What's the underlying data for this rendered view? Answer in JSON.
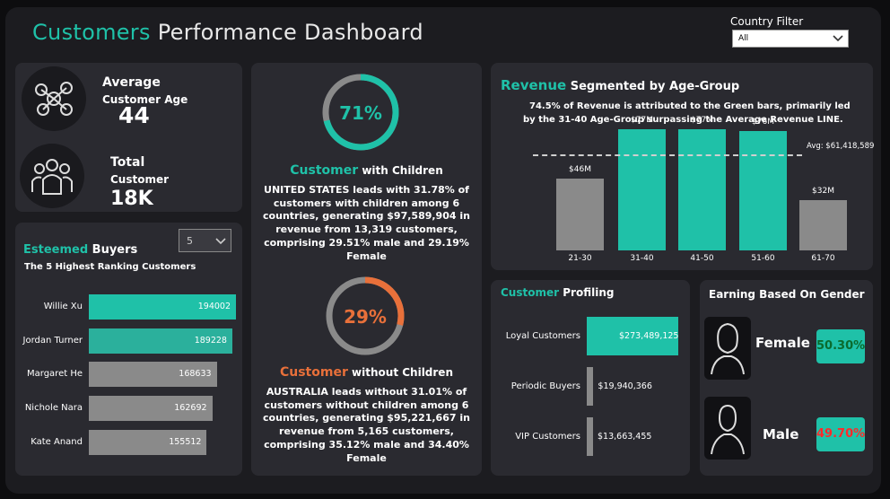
{
  "header": {
    "title_accent": "Customers",
    "title_rest": "Performance Dashboard",
    "filter_label": "Country Filter",
    "filter_value": "All"
  },
  "kpis": {
    "avg_age_label_1": "Average",
    "avg_age_label_2": "Customer Age",
    "avg_age_value": "44",
    "total_label_1": "Total",
    "total_label_2": "Customer",
    "total_value": "18K"
  },
  "buyers": {
    "title_accent": "Esteemed",
    "title_rest": "Buyers",
    "subtitle": "The 5 Highest Ranking Customers",
    "top_n": "5",
    "rows": [
      {
        "name": "Willie Xu",
        "value": 194002,
        "label": "194002",
        "color": "#1fc1a8"
      },
      {
        "name": "Jordan Turner",
        "value": 189228,
        "label": "189228",
        "color": "#2bb09c"
      },
      {
        "name": "Margaret He",
        "value": 168633,
        "label": "168633",
        "color": "#8a8a8a"
      },
      {
        "name": "Nichole Nara",
        "value": 162692,
        "label": "162692",
        "color": "#8a8a8a"
      },
      {
        "name": "Kate Anand",
        "value": 155512,
        "label": "155512",
        "color": "#8a8a8a"
      }
    ]
  },
  "children": {
    "with_pct": "71%",
    "with_fraction": 0.71,
    "with_title_accent": "Customer",
    "with_title_rest": "with Children",
    "with_desc": [
      "UNITED STATES leads with 31.78% of",
      "customers with children among 6",
      "countries, generating $97,589,904 in",
      "revenue from 13,319 customers,",
      "comprising 29.51% male and 29.19%",
      "Female"
    ],
    "without_pct": "29%",
    "without_fraction": 0.29,
    "without_title_accent": "Customer",
    "without_title_rest": "without Children",
    "without_desc": [
      "AUSTRALIA leads without 31.01% of",
      "customers without children among 6",
      "countries, generating $95,221,667 in",
      "revenue from 5,165 customers,",
      "comprising 35.12% male and 34.40%",
      "Female"
    ]
  },
  "revenue": {
    "title_accent": "Revenue",
    "title_rest": "Segmented by Age-Group",
    "desc_1": "74.5% of Revenue is attributed to the Green bars, primarily led",
    "desc_2": "by the 31-40 Age-Group surpassing the Average Revenue LINE.",
    "avg_label": "Avg: $61,418,589"
  },
  "profiling": {
    "title_accent": "Customer",
    "title_rest": "Profiling",
    "rows": [
      {
        "name": "Loyal Customers",
        "value": 273489125,
        "label": "$273,489,125"
      },
      {
        "name": "Periodic Buyers",
        "value": 19940366,
        "label": "$19,940,366"
      },
      {
        "name": "VIP Customers",
        "value": 13663455,
        "label": "$13,663,455"
      }
    ]
  },
  "gender": {
    "title": "Earning Based On Gender",
    "female_label": "Female",
    "female_pct": "50.30%",
    "male_label": "Male",
    "male_pct": "49.70%"
  },
  "colors": {
    "accent": "#1fc1a8",
    "orange": "#e8703a",
    "gray_bar": "#8a8a8a",
    "male_pct_text": "#ff2a2a",
    "female_pct_text": "#0a6b2e"
  },
  "chart_data": {
    "type": "bar",
    "title": "Revenue Segmented by Age-Group",
    "categories": [
      "21-30",
      "31-40",
      "41-50",
      "51-60",
      "61-70"
    ],
    "values": [
      46,
      77,
      77,
      76,
      32
    ],
    "value_labels": [
      "$46M",
      "$77M",
      "$77M",
      "$76M",
      "$32M"
    ],
    "unit": "$M",
    "average": 61.418589,
    "average_label": "Avg: $61,418,589",
    "ylim": [
      0,
      80
    ],
    "bar_colors": [
      "#8a8a8a",
      "#1fc1a8",
      "#1fc1a8",
      "#1fc1a8",
      "#8a8a8a"
    ],
    "grid": false
  }
}
